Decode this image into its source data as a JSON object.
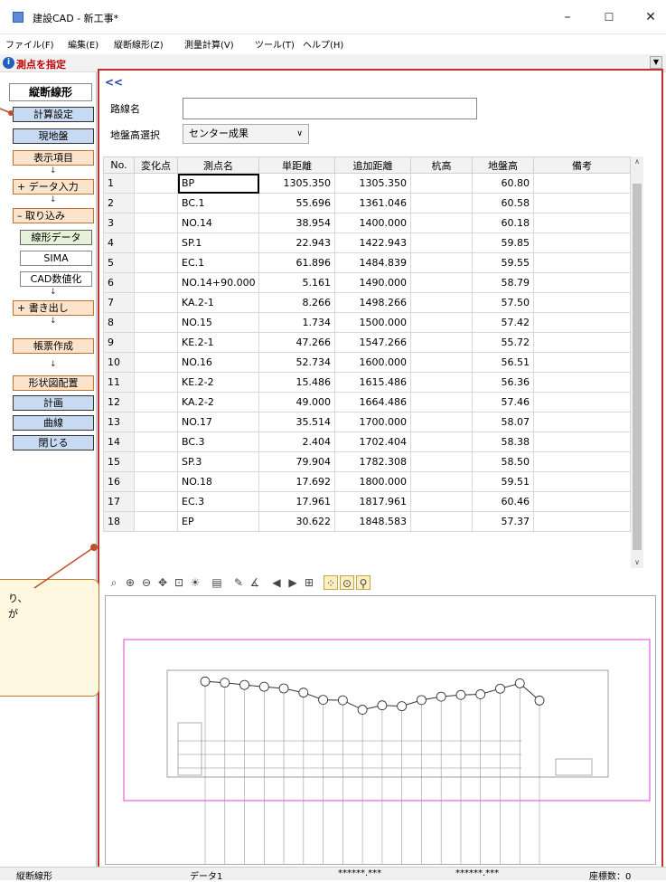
{
  "window": {
    "title": "建設CAD - 新工事*",
    "minimize": "–",
    "maximize": "☐",
    "close": "✕"
  },
  "menu": [
    {
      "label": "ファイル(F)"
    },
    {
      "label": "編集(E)"
    },
    {
      "label": "縦断線形(Z)"
    },
    {
      "label": "測量計算(V)"
    },
    {
      "label": "ツール(T)"
    },
    {
      "label": "ヘルプ(H)"
    }
  ],
  "command": {
    "prompt": "測点を指定"
  },
  "sidebar": {
    "title": "縦断線形",
    "calc_settings": "計算設定",
    "ground": "現地盤",
    "display_items": "表示項目",
    "data_input": "+ データ入力",
    "import": "– 取り込み",
    "line_data": "線形データ",
    "sima": "SIMA",
    "cad_digitize": "CAD数値化",
    "export": "+ 書き出し",
    "report": "帳票作成",
    "shape_layout": "形状図配置",
    "plan": "計画",
    "curve": "曲線",
    "close": "閉じる",
    "arrow": "↓"
  },
  "form": {
    "collapse_icon": "<<",
    "route_name_label": "路線名",
    "route_name_value": "",
    "ground_select_label": "地盤高選択",
    "ground_select_value": "センター成果"
  },
  "table": {
    "headers": [
      "No.",
      "変化点",
      "測点名",
      "単距離",
      "追加距離",
      "杭高",
      "地盤高",
      "備考"
    ],
    "rows": [
      {
        "no": "1",
        "point": "BP",
        "single": "1305.350",
        "cumulative": "1305.350",
        "ground": "60.80"
      },
      {
        "no": "2",
        "point": "BC.1",
        "single": "55.696",
        "cumulative": "1361.046",
        "ground": "60.58"
      },
      {
        "no": "3",
        "point": "NO.14",
        "single": "38.954",
        "cumulative": "1400.000",
        "ground": "60.18"
      },
      {
        "no": "4",
        "point": "SP.1",
        "single": "22.943",
        "cumulative": "1422.943",
        "ground": "59.85"
      },
      {
        "no": "5",
        "point": "EC.1",
        "single": "61.896",
        "cumulative": "1484.839",
        "ground": "59.55"
      },
      {
        "no": "6",
        "point": "NO.14+90.000",
        "single": "5.161",
        "cumulative": "1490.000",
        "ground": "58.79"
      },
      {
        "no": "7",
        "point": "KA.2-1",
        "single": "8.266",
        "cumulative": "1498.266",
        "ground": "57.50"
      },
      {
        "no": "8",
        "point": "NO.15",
        "single": "1.734",
        "cumulative": "1500.000",
        "ground": "57.42"
      },
      {
        "no": "9",
        "point": "KE.2-1",
        "single": "47.266",
        "cumulative": "1547.266",
        "ground": "55.72"
      },
      {
        "no": "10",
        "point": "NO.16",
        "single": "52.734",
        "cumulative": "1600.000",
        "ground": "56.51"
      },
      {
        "no": "11",
        "point": "KE.2-2",
        "single": "15.486",
        "cumulative": "1615.486",
        "ground": "56.36"
      },
      {
        "no": "12",
        "point": "KA.2-2",
        "single": "49.000",
        "cumulative": "1664.486",
        "ground": "57.46"
      },
      {
        "no": "13",
        "point": "NO.17",
        "single": "35.514",
        "cumulative": "1700.000",
        "ground": "58.07"
      },
      {
        "no": "14",
        "point": "BC.3",
        "single": "2.404",
        "cumulative": "1702.404",
        "ground": "58.38"
      },
      {
        "no": "15",
        "point": "SP.3",
        "single": "79.904",
        "cumulative": "1782.308",
        "ground": "58.50"
      },
      {
        "no": "16",
        "point": "NO.18",
        "single": "17.692",
        "cumulative": "1800.000",
        "ground": "59.51"
      },
      {
        "no": "17",
        "point": "EC.3",
        "single": "17.961",
        "cumulative": "1817.961",
        "ground": "60.46"
      },
      {
        "no": "18",
        "point": "EP",
        "single": "30.622",
        "cumulative": "1848.583",
        "ground": "57.37"
      }
    ]
  },
  "profile": {
    "ground_levels": [
      60.8,
      60.58,
      60.18,
      59.85,
      59.55,
      58.79,
      57.5,
      57.42,
      55.72,
      56.51,
      56.36,
      57.46,
      58.07,
      58.38,
      58.5,
      59.51,
      60.46,
      57.37
    ],
    "labels": [
      "BP",
      "BC.1",
      "NO.14",
      "SP.1",
      "EC.1",
      "NO.14+90.000",
      "KA.2-1",
      "NO.15",
      "KE.2-1",
      "NO.16",
      "KE.2-2",
      "KA.2-2",
      "NO.17",
      "BC.3",
      "SP.3",
      "NO.18",
      "EC.3",
      "EP"
    ]
  },
  "callout": {
    "line1": "り、",
    "line2": "が"
  },
  "status": {
    "mode": "縦断線形",
    "data": "データ1",
    "coord1": "******.***",
    "coord2": "******.***",
    "count": "座標数：0"
  },
  "colors": {
    "accent_red": "#c0302c",
    "sheet_border": "#e040e0",
    "button_blue": "#c8daf2",
    "button_orange": "#fce4cc"
  }
}
